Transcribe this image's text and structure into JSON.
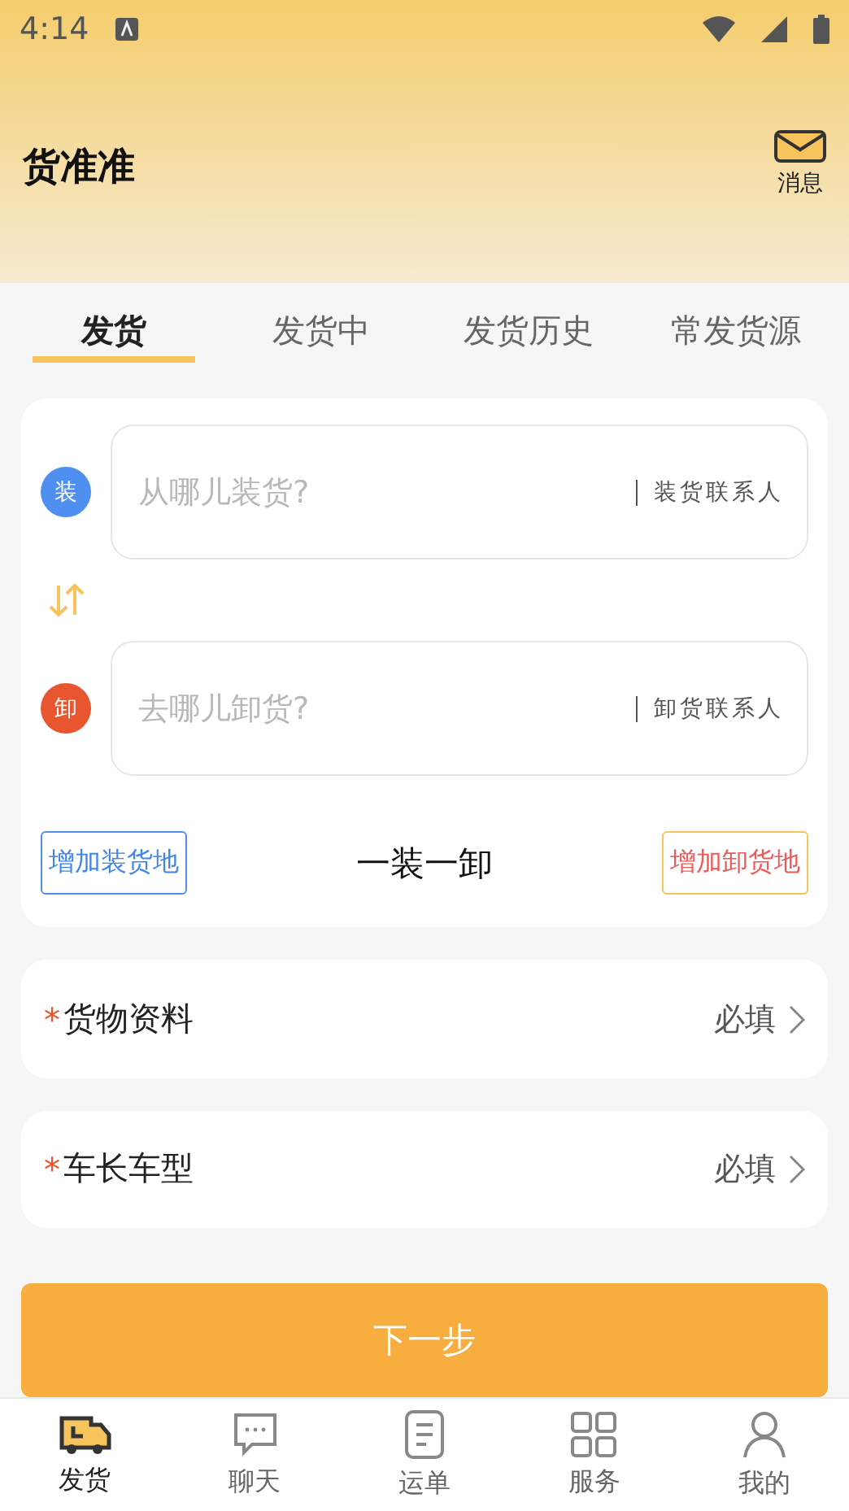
{
  "status_bar": {
    "time": "4:14"
  },
  "header": {
    "title": "货准准",
    "message_label": "消息"
  },
  "tabs": [
    {
      "label": "发货",
      "selected": true
    },
    {
      "label": "发货中",
      "selected": false
    },
    {
      "label": "发货历史",
      "selected": false
    },
    {
      "label": "常发货源",
      "selected": false
    }
  ],
  "route": {
    "stops": [
      {
        "badge": "装",
        "color": "#4f8ff0",
        "placeholder": "从哪儿装货?",
        "contact": "装货联系人"
      },
      {
        "badge": "卸",
        "color": "#e8562f",
        "placeholder": "去哪儿卸货?",
        "contact": "卸货联系人"
      }
    ],
    "add_load": "增加装货地",
    "summary": "一装一卸",
    "add_unload": "增加卸货地"
  },
  "fields": [
    {
      "required_mark": "*",
      "label": "货物资料",
      "required": true,
      "value": "必填"
    },
    {
      "required_mark": "*",
      "label": "车长车型",
      "required": true,
      "value": "必填"
    }
  ],
  "next_button": "下一步",
  "bottom_nav": [
    {
      "kind": "truck",
      "label": "发货",
      "selected": true
    },
    {
      "kind": "chat",
      "label": "聊天",
      "selected": false
    },
    {
      "kind": "document",
      "label": "运单",
      "selected": false
    },
    {
      "kind": "grid",
      "label": "服务",
      "selected": false
    },
    {
      "kind": "person",
      "label": "我的",
      "selected": false
    }
  ]
}
